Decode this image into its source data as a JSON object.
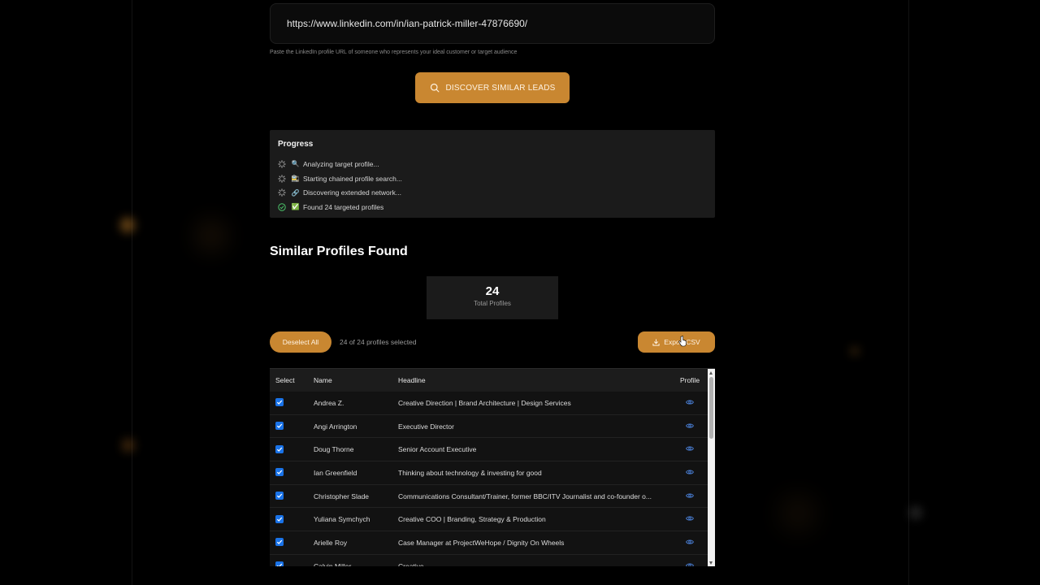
{
  "url_input": {
    "value": "https://www.linkedin.com/in/ian-patrick-miller-47876690/",
    "hint": "Paste the LinkedIn profile URL of someone who represents your ideal customer or target audience"
  },
  "discover_button": {
    "label": "DISCOVER SIMILAR LEADS",
    "icon": "search-icon"
  },
  "progress": {
    "title": "Progress",
    "steps": [
      {
        "status": "spinner",
        "emoji": "🔍",
        "text": "Analyzing target profile..."
      },
      {
        "status": "spinner",
        "emoji": "🚉",
        "text": "Starting chained profile search..."
      },
      {
        "status": "spinner",
        "emoji": "🔗",
        "text": "Discovering extended network..."
      },
      {
        "status": "done",
        "emoji": "✅",
        "text": "Found 24 targeted profiles"
      }
    ]
  },
  "results": {
    "title": "Similar Profiles Found",
    "total": "24",
    "total_label": "Total Profiles",
    "deselect_label": "Deselect All",
    "selected_text": "24 of 24 profiles selected",
    "export_label": "Export CSV"
  },
  "table": {
    "headers": {
      "select": "Select",
      "name": "Name",
      "headline": "Headline",
      "profile": "Profile"
    },
    "rows": [
      {
        "name": "Andrea Z.",
        "headline": "Creative Direction | Brand Architecture | Design Services"
      },
      {
        "name": "Angi Arrington",
        "headline": "Executive Director"
      },
      {
        "name": "Doug Thorne",
        "headline": "Senior Account Executive"
      },
      {
        "name": "Ian Greenfield",
        "headline": "Thinking about technology & investing for good"
      },
      {
        "name": "Christopher Slade",
        "headline": "Communications Consultant/Trainer, former BBC/ITV Journalist and co-founder o..."
      },
      {
        "name": "Yuliana Symchych",
        "headline": "Creative COO | Branding, Strategy & Production"
      },
      {
        "name": "Arielle Roy",
        "headline": "Case Manager at ProjectWeHope / Dignity On Wheels"
      },
      {
        "name": "Calvin Miller",
        "headline": "Creative"
      }
    ]
  },
  "colors": {
    "accent": "#c98731",
    "panel": "#1b1b1b",
    "checkbox": "#1a73e8",
    "eye": "#4a7fd6"
  }
}
